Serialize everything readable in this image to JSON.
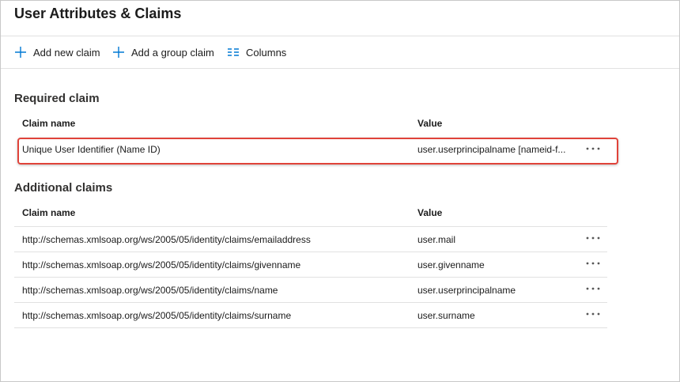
{
  "page": {
    "title": "User Attributes & Claims"
  },
  "toolbar": {
    "add_claim_label": "Add new claim",
    "add_group_claim_label": "Add a group claim",
    "columns_label": "Columns"
  },
  "required": {
    "section_title": "Required claim",
    "headers": {
      "name": "Claim name",
      "value": "Value"
    },
    "rows": [
      {
        "name": "Unique User Identifier (Name ID)",
        "value": "user.userprincipalname [nameid-f..."
      }
    ]
  },
  "additional": {
    "section_title": "Additional claims",
    "headers": {
      "name": "Claim name",
      "value": "Value"
    },
    "rows": [
      {
        "name": "http://schemas.xmlsoap.org/ws/2005/05/identity/claims/emailaddress",
        "value": "user.mail"
      },
      {
        "name": "http://schemas.xmlsoap.org/ws/2005/05/identity/claims/givenname",
        "value": "user.givenname"
      },
      {
        "name": "http://schemas.xmlsoap.org/ws/2005/05/identity/claims/name",
        "value": "user.userprincipalname"
      },
      {
        "name": "http://schemas.xmlsoap.org/ws/2005/05/identity/claims/surname",
        "value": "user.surname"
      }
    ]
  },
  "colors": {
    "accent": "#0078d4",
    "highlight": "#e0433a"
  },
  "icons": {
    "add": "plus-icon",
    "columns": "columns-icon",
    "more": "more-options-icon"
  }
}
